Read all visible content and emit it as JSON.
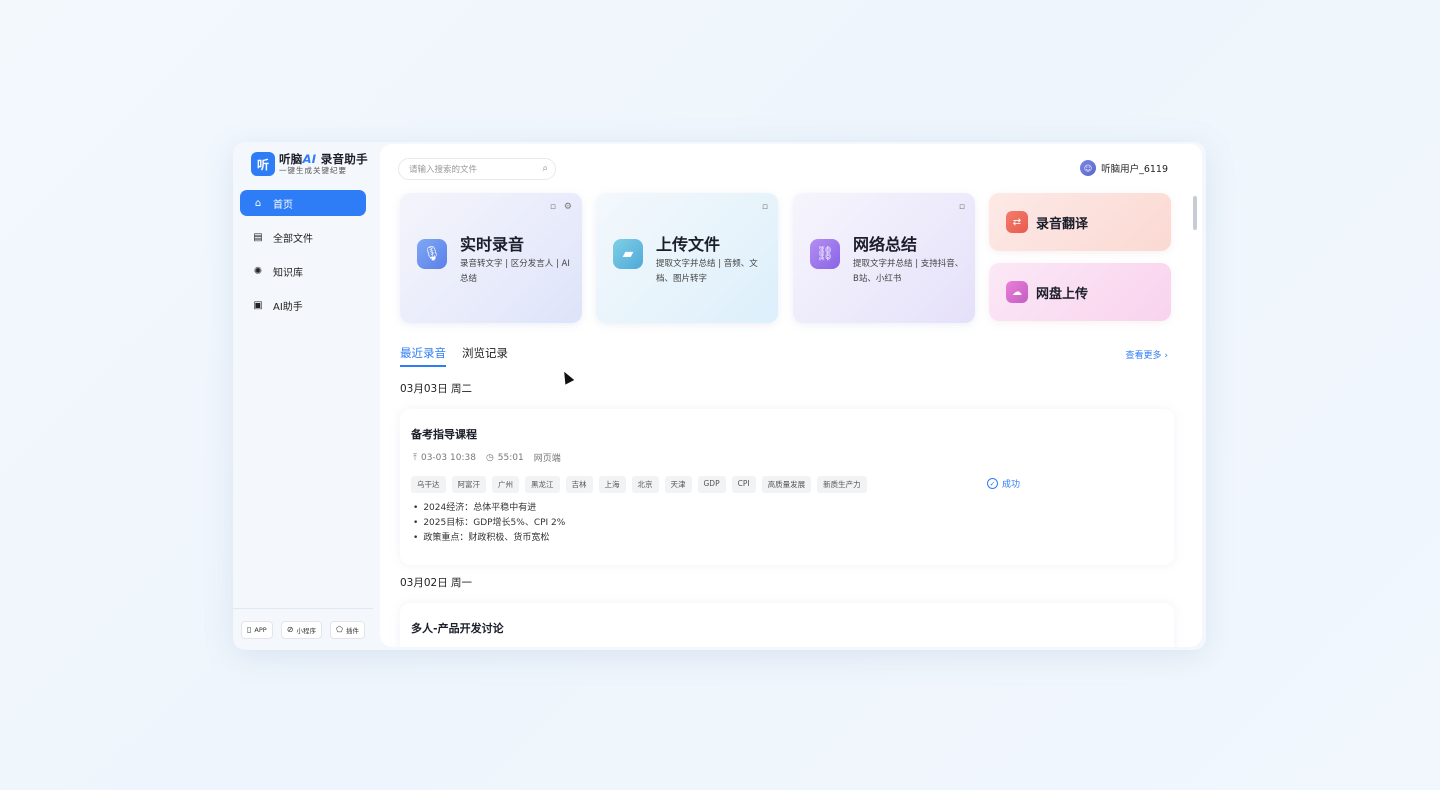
{
  "sidebar": {
    "logo": {
      "mark": "听",
      "brand": "听脑",
      "ai": "AI",
      "product": "录音助手",
      "tagline": "一键生成关键纪要"
    },
    "items": [
      {
        "label": "首页",
        "icon": "home-icon",
        "active": true
      },
      {
        "label": "全部文件",
        "icon": "file-icon",
        "active": false
      },
      {
        "label": "知识库",
        "icon": "bulb-icon",
        "active": false
      },
      {
        "label": "AI助手",
        "icon": "chat-icon",
        "active": false
      }
    ],
    "footer": [
      {
        "label": "APP",
        "icon": "phone-icon"
      },
      {
        "label": "小程序",
        "icon": "miniprogram-icon"
      },
      {
        "label": "插件",
        "icon": "plugin-icon"
      }
    ]
  },
  "header": {
    "search_placeholder": "请输入搜索的文件",
    "user_name": "听脑用户_6119"
  },
  "cards": [
    {
      "title": "实时录音",
      "desc": "录音转文字 | 区分发言人 | AI总结",
      "icon": "microphone-icon"
    },
    {
      "title": "上传文件",
      "desc": "提取文字并总结 | 音频、文档、图片转字",
      "icon": "folder-upload-icon"
    },
    {
      "title": "网络总结",
      "desc": "提取文字并总结 | 支持抖音、B站、小红书",
      "icon": "link-icon"
    }
  ],
  "mini_cards": [
    {
      "title": "录音翻译",
      "icon": "translate-icon"
    },
    {
      "title": "网盘上传",
      "icon": "cloud-upload-icon"
    }
  ],
  "tabs": [
    {
      "label": "最近录音",
      "active": true
    },
    {
      "label": "浏览记录",
      "active": false
    }
  ],
  "see_more": "查看更多 ›",
  "groups": [
    {
      "date": "03月03日 周二",
      "records": [
        {
          "title": "备考指导课程",
          "time": "03-03 10:38",
          "duration": "55:01",
          "source": "网页端",
          "tags": [
            "乌干达",
            "阿富汗",
            "广州",
            "黑龙江",
            "吉林",
            "上海",
            "北京",
            "天津",
            "GDP",
            "CPI",
            "高质量发展",
            "新质生产力"
          ],
          "status": "成功",
          "bullets": [
            "2024经济：总体平稳中有进",
            "2025目标：GDP增长5%、CPI 2%",
            "政策重点：财政积极、货币宽松"
          ]
        }
      ]
    },
    {
      "date": "03月02日 周一",
      "records": [
        {
          "title": "多人-产品开发讨论"
        }
      ]
    }
  ],
  "colors": {
    "accent": "#2f7df6"
  }
}
